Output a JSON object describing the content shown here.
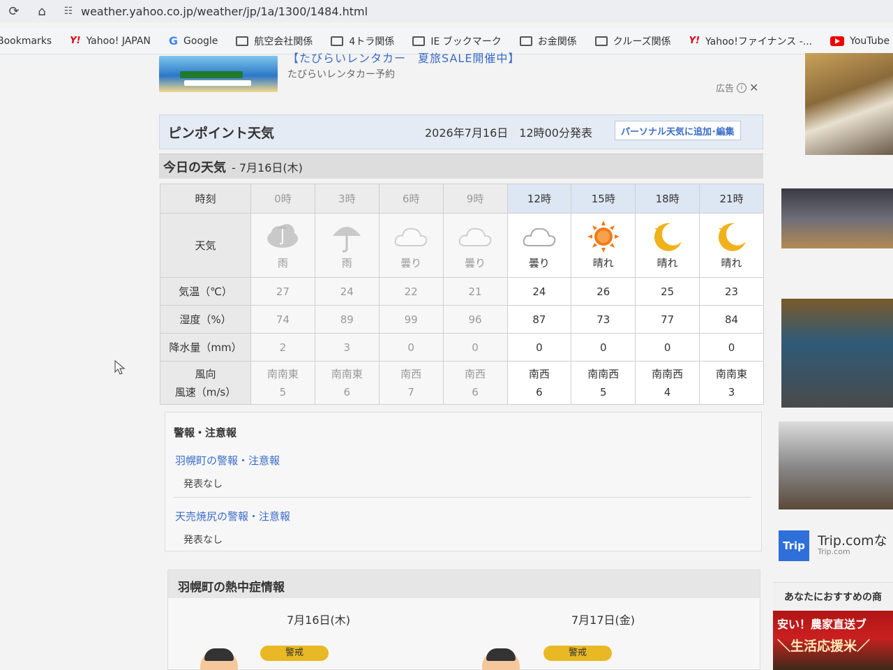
{
  "browser": {
    "url": "weather.yahoo.co.jp/weather/jp/1a/1300/1484.html",
    "bookmarks": [
      {
        "label": "Bookmarks",
        "icon": "none"
      },
      {
        "label": "Yahoo! JAPAN",
        "icon": "yahoo-icon"
      },
      {
        "label": "Google",
        "icon": "google-icon"
      },
      {
        "label": "航空会社関係",
        "icon": "folder-icon"
      },
      {
        "label": "4トラ関係",
        "icon": "folder-icon"
      },
      {
        "label": "IE ブックマーク",
        "icon": "folder-icon"
      },
      {
        "label": "お金関係",
        "icon": "folder-icon"
      },
      {
        "label": "クルーズ関係",
        "icon": "folder-icon"
      },
      {
        "label": "Yahoo!ファイナンス -...",
        "icon": "yahoo-icon"
      },
      {
        "label": "YouTube",
        "icon": "youtube-icon"
      }
    ]
  },
  "ad": {
    "title": "【たびらいレンタカー　夏旅SALE開催中】",
    "subtitle": "たびらいレンタカー予約",
    "label": "広告"
  },
  "pinpoint": {
    "title": "ピンポイント天気",
    "issued": "2026年7月16日　12時00分発表",
    "button": "パーソナル天気に追加･編集"
  },
  "today": {
    "title": "今日の天気",
    "date": "- 7月16日(木)"
  },
  "forecast": {
    "row_labels": {
      "time": "時刻",
      "weather": "天気",
      "temp": "気温（℃）",
      "humidity": "湿度（%）",
      "precip": "降水量（mm）",
      "wind_dir": "風向",
      "wind_speed": "風速（m/s）"
    },
    "columns": [
      {
        "hour": "0時",
        "weather": "雨",
        "icon": "rain-cloud-icon",
        "temp": "27",
        "humidity": "74",
        "precip": "2",
        "wind_dir": "南南東",
        "wind_speed": "5",
        "past": true
      },
      {
        "hour": "3時",
        "weather": "雨",
        "icon": "umbrella-icon",
        "temp": "24",
        "humidity": "89",
        "precip": "3",
        "wind_dir": "南南東",
        "wind_speed": "6",
        "past": true
      },
      {
        "hour": "6時",
        "weather": "曇り",
        "icon": "cloud-icon",
        "temp": "22",
        "humidity": "99",
        "precip": "0",
        "wind_dir": "南西",
        "wind_speed": "7",
        "past": true
      },
      {
        "hour": "9時",
        "weather": "曇り",
        "icon": "cloud-icon",
        "temp": "21",
        "humidity": "96",
        "precip": "0",
        "wind_dir": "南西",
        "wind_speed": "6",
        "past": true
      },
      {
        "hour": "12時",
        "weather": "曇り",
        "icon": "cloud-icon",
        "temp": "24",
        "humidity": "87",
        "precip": "0",
        "wind_dir": "南西",
        "wind_speed": "6",
        "past": false
      },
      {
        "hour": "15時",
        "weather": "晴れ",
        "icon": "sun-icon",
        "temp": "26",
        "humidity": "73",
        "precip": "0",
        "wind_dir": "南南西",
        "wind_speed": "5",
        "past": false
      },
      {
        "hour": "18時",
        "weather": "晴れ",
        "icon": "moon-icon",
        "temp": "25",
        "humidity": "77",
        "precip": "0",
        "wind_dir": "南南西",
        "wind_speed": "4",
        "past": false
      },
      {
        "hour": "21時",
        "weather": "晴れ",
        "icon": "moon-icon",
        "temp": "23",
        "humidity": "84",
        "precip": "0",
        "wind_dir": "南南東",
        "wind_speed": "3",
        "past": false
      }
    ]
  },
  "warnings": {
    "title": "警報・注意報",
    "items": [
      {
        "link": "羽幌町の警報・注意報",
        "status": "発表なし"
      },
      {
        "link": "天売焼尻の警報・注意報",
        "status": "発表なし"
      }
    ]
  },
  "heatstroke": {
    "title": "羽幌町の熱中症情報",
    "days": [
      {
        "date": "7月16日(木)",
        "level": "警戒"
      },
      {
        "date": "7月17日(金)",
        "level": "警戒"
      }
    ]
  },
  "sidebar": {
    "trip_title": "Trip.comな",
    "trip_sub": "Trip.com",
    "trip_logo": "Trip",
    "rec_title": "あなたにおすすめの商",
    "rec_line1": "安い！農家直送ブ",
    "rec_line2": "＼生活応援米／"
  },
  "colors": {
    "accent_blue": "#3a6cc8",
    "sun": "#f07a1a",
    "moon": "#f0b21a",
    "badge": "#e8b924"
  }
}
